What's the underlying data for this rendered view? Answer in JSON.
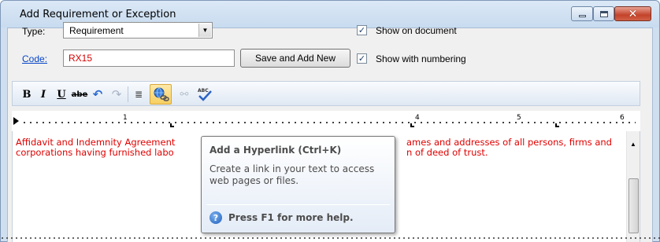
{
  "window": {
    "title": "Add Requirement or Exception",
    "close_glyph": "✕"
  },
  "form": {
    "type_label": "Type:",
    "type_value": "Requirement",
    "code_label": "Code:",
    "code_value": "RX15",
    "save_add_new_label": "Save and Add New",
    "show_on_document_label": "Show on document",
    "show_on_document_checked": true,
    "show_with_numbering_label": "Show with numbering",
    "show_with_numbering_checked": true
  },
  "toolbar": {
    "bold": "B",
    "italic": "I",
    "underline": "U",
    "strike": "abe",
    "undo": "↶",
    "redo": "↷",
    "list": "≣",
    "unlink": "⚯",
    "spell": "ABC"
  },
  "ruler": {
    "numbers": [
      "1",
      "4",
      "5",
      "6"
    ]
  },
  "editor": {
    "line1_left": "Affidavit and Indemnity Agreement",
    "line1_right": "ames and addresses of all persons, firms and",
    "line2_left": "corporations having furnished labo",
    "line2_right": "n of deed of trust."
  },
  "tooltip": {
    "title": "Add a Hyperlink (Ctrl+K)",
    "body": "Create a link in your text to access web pages or files.",
    "help_icon": "?",
    "help_text": "Press F1 for more help."
  }
}
